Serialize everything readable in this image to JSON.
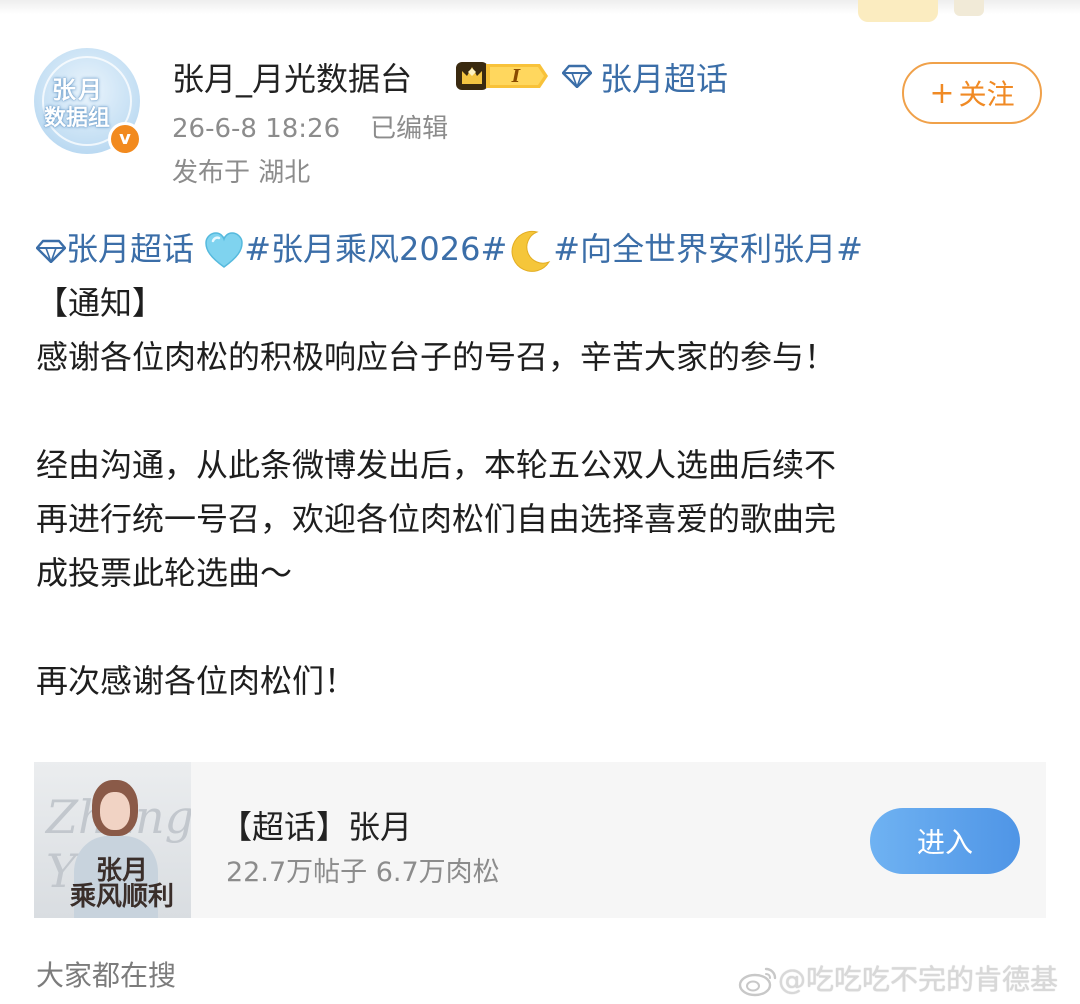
{
  "post": {
    "author": {
      "name": "张月_月光数据台",
      "avatar_text_line1": "张月",
      "avatar_text_line2": "数据组",
      "verified_mark": "v",
      "level_badge": "I"
    },
    "supertopic_link": "张月超话",
    "timestamp": "26-6-8 18:26",
    "edited_label": "已编辑",
    "location": "发布于 湖北",
    "follow_button": {
      "plus": "+",
      "label": "关注"
    },
    "content": {
      "tags": {
        "supertopic": "张月超话",
        "hashtag1": "#张月乘风2026#",
        "hashtag2": "#向全世界安利张月#"
      },
      "notice_title": "【通知】",
      "line1": "感谢各位肉松的积极响应台子的号召，辛苦大家的参与！",
      "paragraph2_lines": [
        "经由沟通，从此条微博发出后，本轮五公双人选曲后续不",
        "再进行统一号召，欢迎各位肉松们自由选择喜爱的歌曲完",
        "成投票此轮选曲～"
      ],
      "closing": "再次感谢各位肉松们！"
    }
  },
  "supertopic_card": {
    "thumb_script": "Zhang Yue",
    "thumb_caption_line1": "张月",
    "thumb_caption_line2": "乘风顺利",
    "title": "【超话】张月",
    "stats": "22.7万帖子 6.7万肉松",
    "enter_button": "进入"
  },
  "footer": {
    "search_section_label": "大家都在搜",
    "watermark": "@吃吃吃不完的肯德基"
  },
  "colors": {
    "link_blue": "#3b6ea8",
    "follow_orange": "#f08a24",
    "enter_blue": "#4f95e6",
    "meta_gray": "#8c8c8c",
    "verified_orange": "#f28a1e"
  }
}
